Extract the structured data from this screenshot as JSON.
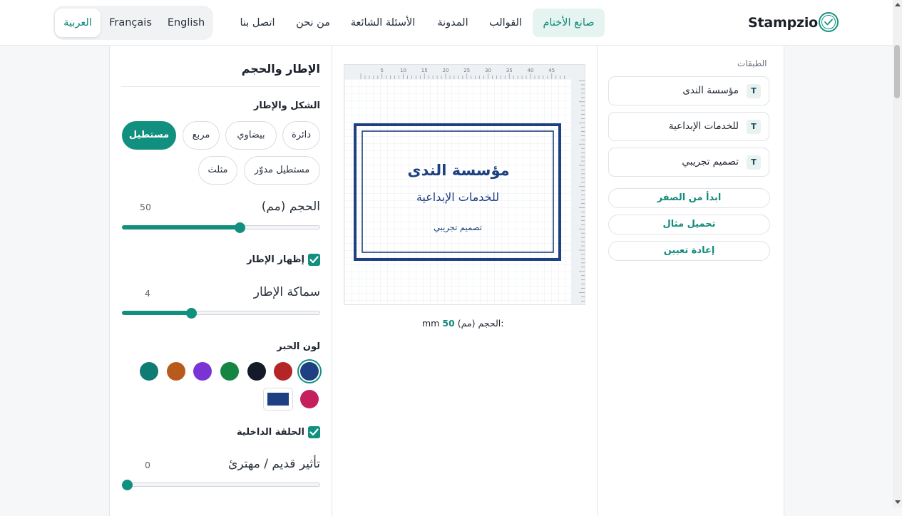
{
  "header": {
    "logo_text": "Stampzio",
    "nav": [
      {
        "label": "صانع الأختام",
        "active": true
      },
      {
        "label": "القوالب"
      },
      {
        "label": "المدونة"
      },
      {
        "label": "الأسئلة الشائعة"
      },
      {
        "label": "من نحن"
      },
      {
        "label": "اتصل بنا"
      }
    ],
    "languages": [
      {
        "label": "English"
      },
      {
        "label": "Français"
      },
      {
        "label": "العربية",
        "active": true
      }
    ]
  },
  "layers_panel": {
    "title": "الطبقات",
    "layers": [
      {
        "name": "مؤسسة الندى",
        "badge": "T"
      },
      {
        "name": "للخدمات الإبداعية",
        "badge": "T"
      },
      {
        "name": "تصميم تجريبي",
        "badge": "T"
      }
    ],
    "actions": {
      "start_blank": "ابدأ من الصفر",
      "load_example": "تحميل مثال",
      "reset": "إعادة تعيين"
    }
  },
  "canvas": {
    "ruler_labels": [
      "5",
      "10",
      "15",
      "20",
      "25",
      "30",
      "35",
      "40",
      "45"
    ],
    "stamp": {
      "line1": "مؤسسة الندى",
      "line2": "للخدمات الإبداعية",
      "line3": "تصميم تجريبي",
      "color": "#1e3f82"
    },
    "size_label": "الحجم (مم):",
    "size_value": "50",
    "size_unit": "mm"
  },
  "settings_panel": {
    "title": "الإطار والحجم",
    "shape_section_label": "الشكل والإطار",
    "shapes": [
      {
        "label": "مستطيل",
        "active": true
      },
      {
        "label": "مربع"
      },
      {
        "label": "بيضاوي"
      },
      {
        "label": "دائرة"
      },
      {
        "label": "مثلث"
      },
      {
        "label": "مستطيل مدوّر"
      }
    ],
    "size": {
      "label": "الحجم (مم)",
      "value": "50",
      "fraction": 0.6
    },
    "show_border": {
      "label": "إظهار الإطار",
      "checked": true
    },
    "border_thickness": {
      "label": "سماكة الإطار",
      "value": "4",
      "fraction": 0.34
    },
    "ink_color_label": "لون الحبر",
    "ink_colors": [
      {
        "name": "blue",
        "hex": "#1e3f82",
        "selected": true
      },
      {
        "name": "red",
        "hex": "#b42528"
      },
      {
        "name": "black",
        "hex": "#141a27"
      },
      {
        "name": "green",
        "hex": "#168541"
      },
      {
        "name": "purple",
        "hex": "#7b34d4"
      },
      {
        "name": "orange",
        "hex": "#b75a1c"
      },
      {
        "name": "teal",
        "hex": "#107b72"
      },
      {
        "name": "crimson",
        "hex": "#c51f5d"
      }
    ],
    "custom_color": "#1e3f82",
    "inner_ring": {
      "label": "الحلقة الداخلية",
      "checked": true
    },
    "vintage": {
      "label": "تأثير قديم / مهترئ",
      "value": "0",
      "fraction": 0.0
    }
  }
}
